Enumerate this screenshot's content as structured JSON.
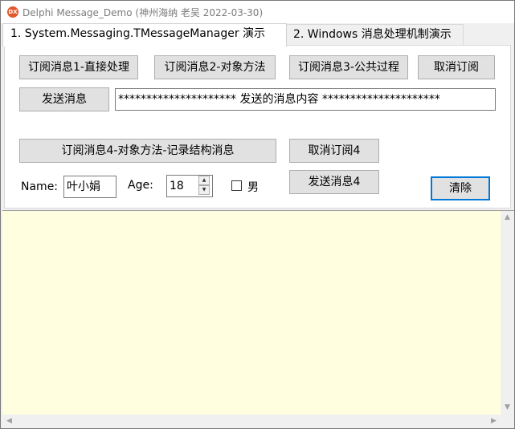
{
  "window": {
    "title": "Delphi Message_Demo  (神州海纳 老吴 2022-03-30)",
    "icon_letters": "DX",
    "icon_color": "#e2572c"
  },
  "tabs": [
    {
      "label": "1.  System.Messaging.TMessageManager 演示",
      "active": true
    },
    {
      "label": "2. Windows 消息处理机制演示",
      "active": false
    }
  ],
  "buttons": {
    "sub1": "订阅消息1-直接处理",
    "sub2": "订阅消息2-对象方法",
    "sub3": "订阅消息3-公共过程",
    "unsub": "取消订阅",
    "send": "发送消息",
    "sub4": "订阅消息4-对象方法-记录结构消息",
    "unsub4": "取消订阅4",
    "send4": "发送消息4",
    "clear": "清除"
  },
  "message_field": {
    "value": "********************* 发送的消息内容  *********************"
  },
  "form": {
    "name_label": "Name:",
    "name_value": "叶小娟",
    "age_label": "Age:",
    "age_value": "18",
    "male_label": "男",
    "male_checked": false
  },
  "memo": {
    "background": "#ffffe0",
    "lines": []
  }
}
